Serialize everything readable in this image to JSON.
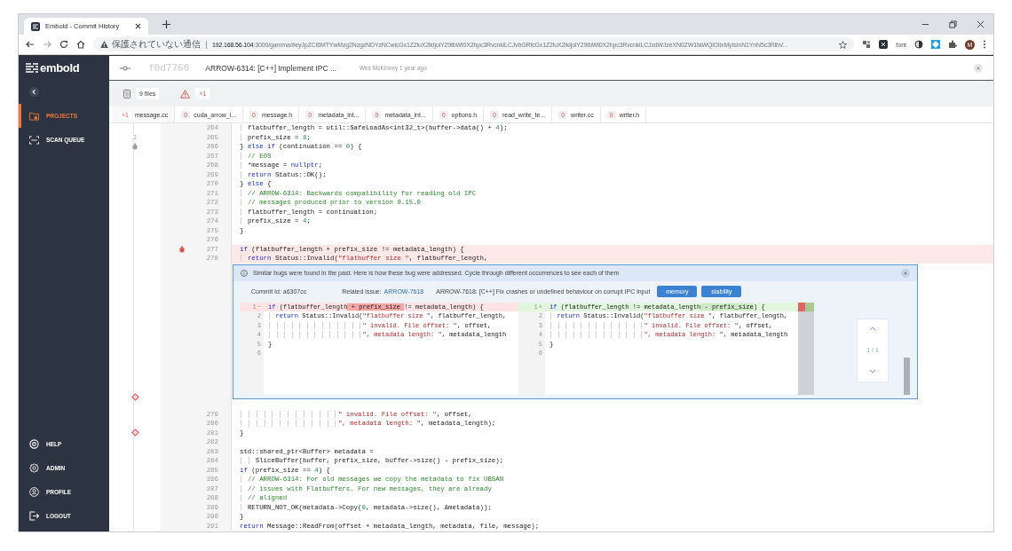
{
  "browser": {
    "tab_title": "Embold - Commit History",
    "security_label": "保護されていない通信",
    "url_host": "192.168.56.104",
    "url_path": ":3000/gamma/#eyJpZCI6MTYwMzg2NzgzNDYzNCwicGx1Z2luX2lkIjoiY29tbWl0X2hpc3RvcnkiLCJvbGRfcGx1Z2luX2lkIjoiY29tbWl0X2hpc3RvcnkiLCJzdWJzeXN0ZW1faWQiOiIxMyIsInN1YnN5c3RlbV...",
    "extension_label": "font",
    "avatar_initial": "M"
  },
  "sidebar": {
    "logo": "embold",
    "nav": [
      {
        "label": "PROJECTS",
        "selected": true
      },
      {
        "label": "SCAN QUEUE",
        "selected": false
      }
    ],
    "footer": [
      {
        "label": "HELP"
      },
      {
        "label": "ADMIN"
      },
      {
        "label": "PROFILE"
      },
      {
        "label": "LOGOUT"
      }
    ]
  },
  "commit": {
    "hash": "f0d7760",
    "title": "ARROW-6314: [C++] Implement IPC ...",
    "meta": "Wes McKinney 1 year ago"
  },
  "toolbar": {
    "files": "9 files",
    "issues": "+1"
  },
  "file_tabs": [
    {
      "count": "+1",
      "name": "message.cc",
      "selected": true
    },
    {
      "count": "0",
      "name": "cuda_arrow_i...",
      "selected": false
    },
    {
      "count": "0",
      "name": "message.h",
      "selected": false
    },
    {
      "count": "0",
      "name": "metadata_int...",
      "selected": false
    },
    {
      "count": "0",
      "name": "metadata_int...",
      "selected": false
    },
    {
      "count": "0",
      "name": "options.h",
      "selected": false
    },
    {
      "count": "0",
      "name": "read_write_te...",
      "selected": false
    },
    {
      "count": "0",
      "name": "writer.cc",
      "selected": false
    },
    {
      "count": "0",
      "name": "writer.h",
      "selected": false
    }
  ],
  "code_top": [
    {
      "num": "264",
      "flagged": false,
      "tokens": [
        {
          "kind": "plain",
          "text": "  flatbuffer_length = util::SafeLoadAs<int32_t>(buffer->data() + "
        },
        {
          "kind": "number",
          "text": "4"
        },
        {
          "kind": "plain",
          "text": ");"
        }
      ]
    },
    {
      "num": "265",
      "flagged": false,
      "gutter": {
        "kind": "count",
        "text": "2"
      },
      "tokens": [
        {
          "kind": "plain",
          "text": "  prefix_size = "
        },
        {
          "kind": "number",
          "text": "8"
        },
        {
          "kind": "plain",
          "text": ";"
        }
      ]
    },
    {
      "num": "266",
      "flagged": false,
      "gutter": {
        "kind": "bug"
      },
      "tokens": [
        {
          "kind": "plain",
          "text": "} "
        },
        {
          "kind": "keyword",
          "text": "else if"
        },
        {
          "kind": "plain",
          "text": " (continuation == "
        },
        {
          "kind": "number",
          "text": "0"
        },
        {
          "kind": "plain",
          "text": ") {"
        }
      ]
    },
    {
      "num": "267",
      "flagged": false,
      "tokens": [
        {
          "kind": "comment",
          "text": "  // EOS"
        }
      ]
    },
    {
      "num": "268",
      "flagged": false,
      "tokens": [
        {
          "kind": "plain",
          "text": "  *message = "
        },
        {
          "kind": "keyword",
          "text": "nullptr"
        },
        {
          "kind": "plain",
          "text": ";"
        }
      ]
    },
    {
      "num": "269",
      "flagged": false,
      "tokens": [
        {
          "kind": "keyword",
          "text": "  return"
        },
        {
          "kind": "plain",
          "text": " Status::OK();"
        }
      ]
    },
    {
      "num": "270",
      "flagged": false,
      "tokens": [
        {
          "kind": "plain",
          "text": "} "
        },
        {
          "kind": "keyword",
          "text": "else"
        },
        {
          "kind": "plain",
          "text": " {"
        }
      ]
    },
    {
      "num": "271",
      "flagged": false,
      "tokens": [
        {
          "kind": "comment",
          "text": "  // ARROW-6314: Backwards compatibility for reading old IPC"
        }
      ]
    },
    {
      "num": "272",
      "flagged": false,
      "tokens": [
        {
          "kind": "comment",
          "text": "  // messages produced prior to version 0.15.0"
        }
      ]
    },
    {
      "num": "273",
      "flagged": false,
      "tokens": [
        {
          "kind": "plain",
          "text": "  flatbuffer_length = continuation;"
        }
      ]
    },
    {
      "num": "274",
      "flagged": false,
      "tokens": [
        {
          "kind": "plain",
          "text": "  prefix_size = "
        },
        {
          "kind": "number",
          "text": "4"
        },
        {
          "kind": "plain",
          "text": ";"
        }
      ]
    },
    {
      "num": "275",
      "flagged": false,
      "tokens": [
        {
          "kind": "plain",
          "text": "}"
        }
      ]
    },
    {
      "num": "276",
      "flagged": false
    },
    {
      "num": "277",
      "flagged": true,
      "number_mark": {
        "kind": "bug"
      },
      "tokens": [
        {
          "kind": "keyword",
          "text": "if"
        },
        {
          "kind": "plain",
          "text": " (flatbuffer_length + prefix_size != metadata_length) {"
        }
      ]
    },
    {
      "num": "278",
      "flagged": true,
      "tokens": [
        {
          "kind": "keyword",
          "text": "  return"
        },
        {
          "kind": "plain",
          "text": " Status::Invalid("
        },
        {
          "kind": "string",
          "text": "\"flatbuffer size \""
        },
        {
          "kind": "plain",
          "text": ", flatbuffer_length,"
        }
      ]
    }
  ],
  "suggestion": {
    "gutter": {
      "kind": "diamond"
    },
    "message": "Similar bugs were found in the past. Here is how these bug were addressed. Cycle through different occurrences to see each of them",
    "commit_label": "Commit Id: a6307cc",
    "issue_label": "Related issue:",
    "issue_link": "ARROW-7618",
    "issue_title": "ARROW-7618: [C++] Fix crashes or undefined behaviour on corrupt IPC input",
    "tags": [
      "memory",
      "stability"
    ],
    "left": [
      {
        "num": "1",
        "kind": "removed",
        "sign": "−",
        "tokens": [
          {
            "kind": "keyword",
            "text": "if"
          },
          {
            "kind": "plain",
            "text": " (flatbuffer_length"
          },
          {
            "kind": "deleted",
            "text": " + prefix_size "
          },
          {
            "kind": "plain",
            "text": "!= metadata_length) {"
          }
        ]
      },
      {
        "num": "2",
        "kind": "context",
        "tokens": [
          {
            "kind": "keyword",
            "text": "  return"
          },
          {
            "kind": "plain",
            "text": " Status::Invalid("
          },
          {
            "kind": "string",
            "text": "\"flatbuffer size \""
          },
          {
            "kind": "plain",
            "text": ", flatbuffer_length,"
          }
        ]
      },
      {
        "num": "3",
        "kind": "context",
        "tokens": [
          {
            "kind": "string",
            "text": "                         \" invalid. File offset: \""
          },
          {
            "kind": "plain",
            "text": ", offset,"
          }
        ]
      },
      {
        "num": "4",
        "kind": "context",
        "tokens": [
          {
            "kind": "string",
            "text": "                         \", metadata length: \""
          },
          {
            "kind": "plain",
            "text": ", metadata_length"
          }
        ]
      },
      {
        "num": "5",
        "kind": "context",
        "tokens": [
          {
            "kind": "plain",
            "text": "}"
          }
        ]
      },
      {
        "num": "6",
        "kind": "context"
      }
    ],
    "right": [
      {
        "num": "1",
        "kind": "added",
        "sign": "+",
        "tokens": [
          {
            "kind": "keyword",
            "text": "if"
          },
          {
            "kind": "plain",
            "text": " (flatbuffer_length != metadata_length"
          },
          {
            "kind": "inserted",
            "text": " - prefix_size"
          },
          {
            "kind": "plain",
            "text": ") {"
          }
        ]
      },
      {
        "num": "2",
        "kind": "context",
        "tokens": [
          {
            "kind": "keyword",
            "text": "  return"
          },
          {
            "kind": "plain",
            "text": " Status::Invalid("
          },
          {
            "kind": "string",
            "text": "\"flatbuffer size \""
          },
          {
            "kind": "plain",
            "text": ", flatbuffer_length,"
          }
        ]
      },
      {
        "num": "3",
        "kind": "context",
        "tokens": [
          {
            "kind": "string",
            "text": "                         \" invalid. File offset: \""
          },
          {
            "kind": "plain",
            "text": ", offset,"
          }
        ]
      },
      {
        "num": "4",
        "kind": "context",
        "tokens": [
          {
            "kind": "string",
            "text": "                         \", metadata length: \""
          },
          {
            "kind": "plain",
            "text": ", metadata_length"
          }
        ]
      },
      {
        "num": "5",
        "kind": "context",
        "tokens": [
          {
            "kind": "plain",
            "text": "}"
          }
        ]
      },
      {
        "num": "6",
        "kind": "context"
      }
    ],
    "pager": "1 / 1"
  },
  "code_bottom": [
    {
      "num": "279",
      "flagged": false,
      "tokens": [
        {
          "kind": "string",
          "text": "                         \" invalid. File offset: \""
        },
        {
          "kind": "plain",
          "text": ", offset,"
        }
      ]
    },
    {
      "num": "280",
      "flagged": false,
      "tokens": [
        {
          "kind": "string",
          "text": "                         \", metadata length: \""
        },
        {
          "kind": "plain",
          "text": ", metadata_length);"
        }
      ]
    },
    {
      "num": "281",
      "flagged": false,
      "gutter": {
        "kind": "diamond"
      },
      "tokens": [
        {
          "kind": "plain",
          "text": "}"
        }
      ]
    },
    {
      "num": "282",
      "flagged": false
    },
    {
      "num": "283",
      "flagged": false,
      "tokens": [
        {
          "kind": "plain",
          "text": "std::shared_ptr<Buffer> metadata ="
        }
      ]
    },
    {
      "num": "284",
      "flagged": false,
      "tokens": [
        {
          "kind": "plain",
          "text": "    SliceBuffer(buffer, prefix_size, buffer->size() - prefix_size);"
        }
      ]
    },
    {
      "num": "285",
      "flagged": false,
      "tokens": [
        {
          "kind": "keyword",
          "text": "if"
        },
        {
          "kind": "plain",
          "text": " (prefix_size == "
        },
        {
          "kind": "number",
          "text": "4"
        },
        {
          "kind": "plain",
          "text": ") {"
        }
      ]
    },
    {
      "num": "286",
      "flagged": false,
      "tokens": [
        {
          "kind": "comment",
          "text": "  // ARROW-6314: For old messages we copy the metadata to fix UBSAN"
        }
      ]
    },
    {
      "num": "287",
      "flagged": false,
      "tokens": [
        {
          "kind": "comment",
          "text": "  // issues with Flatbuffers. For new messages, they are already"
        }
      ]
    },
    {
      "num": "288",
      "flagged": false,
      "tokens": [
        {
          "kind": "comment",
          "text": "  // aligned"
        }
      ]
    },
    {
      "num": "289",
      "flagged": false,
      "tokens": [
        {
          "kind": "plain",
          "text": "  RETURN_NOT_OK(metadata->Copy("
        },
        {
          "kind": "number",
          "text": "0"
        },
        {
          "kind": "plain",
          "text": ", metadata->size(), &metadata));"
        }
      ]
    },
    {
      "num": "290",
      "flagged": false,
      "tokens": [
        {
          "kind": "plain",
          "text": "}"
        }
      ]
    },
    {
      "num": "291",
      "flagged": false,
      "tokens": [
        {
          "kind": "keyword",
          "text": "return"
        },
        {
          "kind": "plain",
          "text": " Message::ReadFrom(offset + metadata_length, metadata, file, message);"
        }
      ]
    }
  ]
}
